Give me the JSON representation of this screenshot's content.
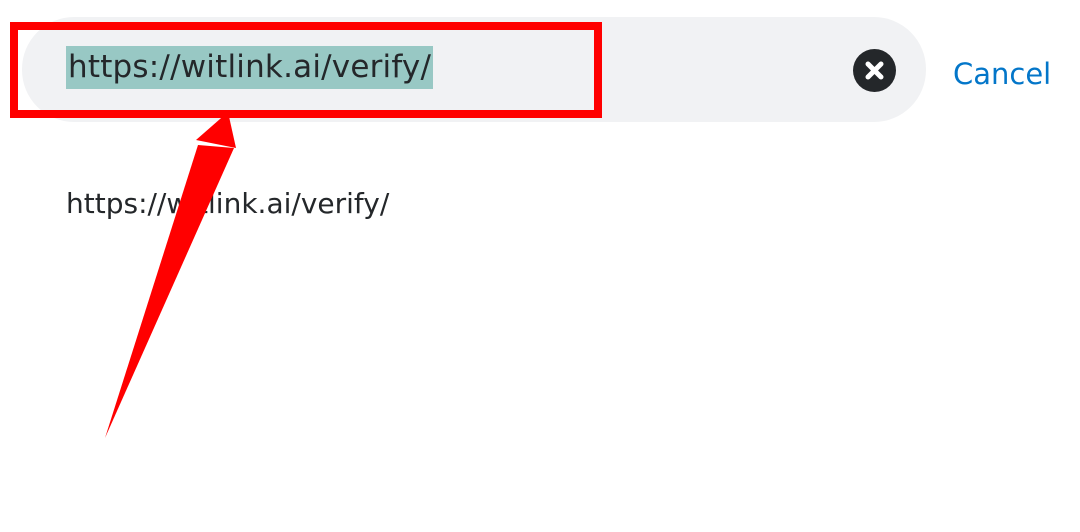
{
  "search": {
    "url_value": "https://witlink.ai/verify/",
    "clear_icon": "close-circle-icon",
    "cancel_label": "Cancel"
  },
  "suggestions": [
    {
      "url": "https://witlink.ai/verify/"
    }
  ],
  "annotation": {
    "color": "#ff0000"
  },
  "colors": {
    "selection": "#98c8c4",
    "cancel": "#0376c9",
    "text": "#24272a",
    "search_bg": "#f1f2f4"
  }
}
